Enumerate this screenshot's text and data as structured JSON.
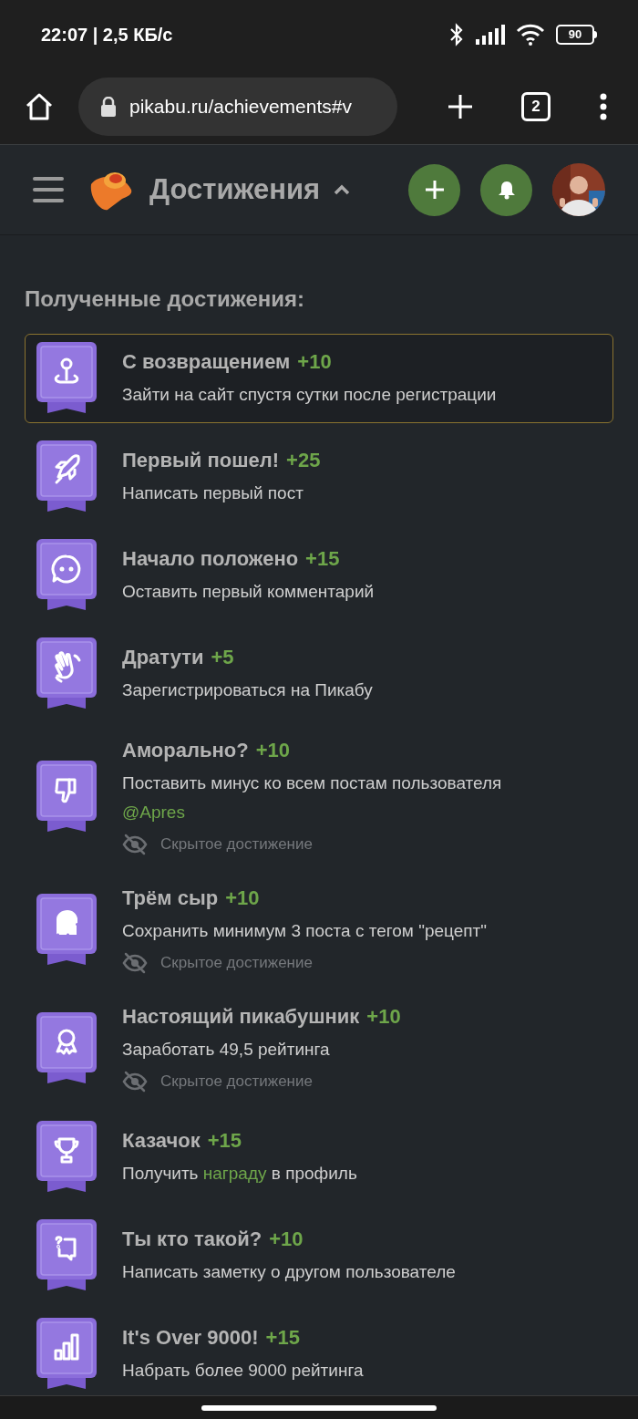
{
  "status_bar": {
    "time": "22:07 | 2,5 КБ/с",
    "battery": "90"
  },
  "browser": {
    "url": "pikabu.ru/achievements#v",
    "tab_count": "2"
  },
  "header": {
    "title": "Достижения",
    "expanded": true
  },
  "section_title": "Полученные достижения:",
  "achievements": [
    {
      "title": "С возвращением",
      "points": "+10",
      "description": [
        {
          "kind": "text",
          "text": "Зайти на сайт спустя сутки после регистрации"
        }
      ],
      "highlighted": true
    },
    {
      "title": "Первый пошел!",
      "points": "+25",
      "description": [
        {
          "kind": "text",
          "text": "Написать первый пост"
        }
      ],
      "highlighted": false
    },
    {
      "title": "Начало положено",
      "points": "+15",
      "description": [
        {
          "kind": "text",
          "text": "Оставить первый комментарий"
        }
      ],
      "highlighted": false
    },
    {
      "title": "Дратути",
      "points": "+5",
      "description": [
        {
          "kind": "text",
          "text": "Зарегистрироваться на Пикабу"
        }
      ],
      "highlighted": false
    },
    {
      "title": "Аморально?",
      "points": "+10",
      "description": [
        {
          "kind": "text",
          "text": "Поставить минус ко всем постам пользователя "
        },
        {
          "kind": "link",
          "text": "@Apres"
        }
      ],
      "note": "Скрытое достижение",
      "highlighted": false
    },
    {
      "title": "Трём сыр",
      "points": "+10",
      "description": [
        {
          "kind": "text",
          "text": "Сохранить минимум 3 поста с тегом \"рецепт\""
        }
      ],
      "note": "Скрытое достижение",
      "highlighted": false
    },
    {
      "title": "Настоящий пикабушник",
      "points": "+10",
      "description": [
        {
          "kind": "text",
          "text": "Заработать 49,5 рейтинга"
        }
      ],
      "note": "Скрытое достижение",
      "highlighted": false
    },
    {
      "title": "Казачок",
      "points": "+15",
      "description": [
        {
          "kind": "text",
          "text": "Получить "
        },
        {
          "kind": "link",
          "text": "награду"
        },
        {
          "kind": "text",
          "text": " в профиль"
        }
      ],
      "highlighted": false
    },
    {
      "title": "Ты кто такой?",
      "points": "+10",
      "description": [
        {
          "kind": "text",
          "text": "Написать заметку о другом пользователе"
        }
      ],
      "highlighted": false
    },
    {
      "title": "It's Over 9000!",
      "points": "+15",
      "description": [
        {
          "kind": "text",
          "text": "Набрать более 9000 рейтинга"
        }
      ],
      "highlighted": false
    }
  ]
}
